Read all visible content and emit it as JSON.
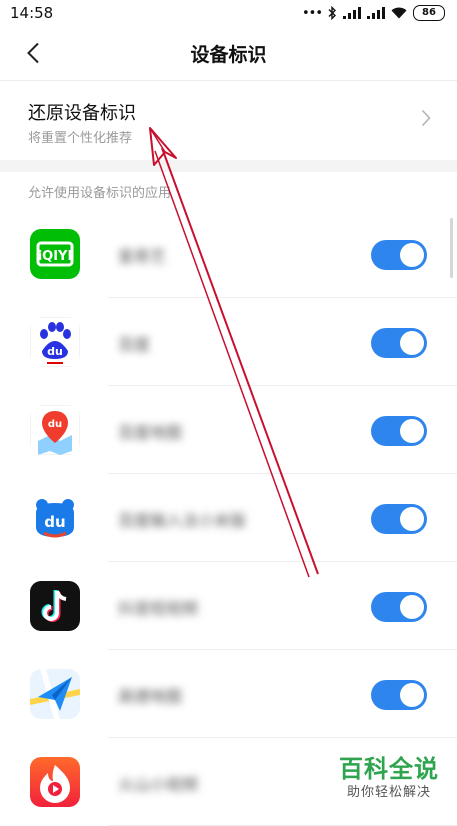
{
  "status_bar": {
    "time": "14:58",
    "dots": "•••",
    "battery": "86",
    "icons": [
      "bluetooth-icon",
      "signal-icon",
      "signal-icon",
      "wifi-icon",
      "battery-icon"
    ]
  },
  "nav": {
    "title": "设备标识",
    "back_icon": "chevron-left-icon"
  },
  "reset": {
    "title": "还原设备标识",
    "subtitle": "将重置个性化推荐",
    "chevron_icon": "chevron-right-icon"
  },
  "section": {
    "header": "允许使用设备标识的应用"
  },
  "apps": [
    {
      "name": "爱奇艺",
      "icon": "iqiyi-app-icon",
      "enabled": true
    },
    {
      "name": "百度",
      "icon": "baidu-app-icon",
      "enabled": true
    },
    {
      "name": "百度地图",
      "icon": "baidu-map-app-icon",
      "enabled": true
    },
    {
      "name": "百度输入法小米版",
      "icon": "baidu-input-app-icon",
      "enabled": true
    },
    {
      "name": "抖音短视频",
      "icon": "douyin-app-icon",
      "enabled": true
    },
    {
      "name": "高德地图",
      "icon": "amap-app-icon",
      "enabled": true
    },
    {
      "name": "火山小视频",
      "icon": "huoshan-app-icon",
      "enabled": true
    }
  ],
  "colors": {
    "toggle_on": "#2e85ee",
    "watermark": "#2fa44f",
    "annotation_arrow": "#c8102e"
  },
  "watermark": {
    "main": "百科全说",
    "sub": "助你轻松解决"
  }
}
